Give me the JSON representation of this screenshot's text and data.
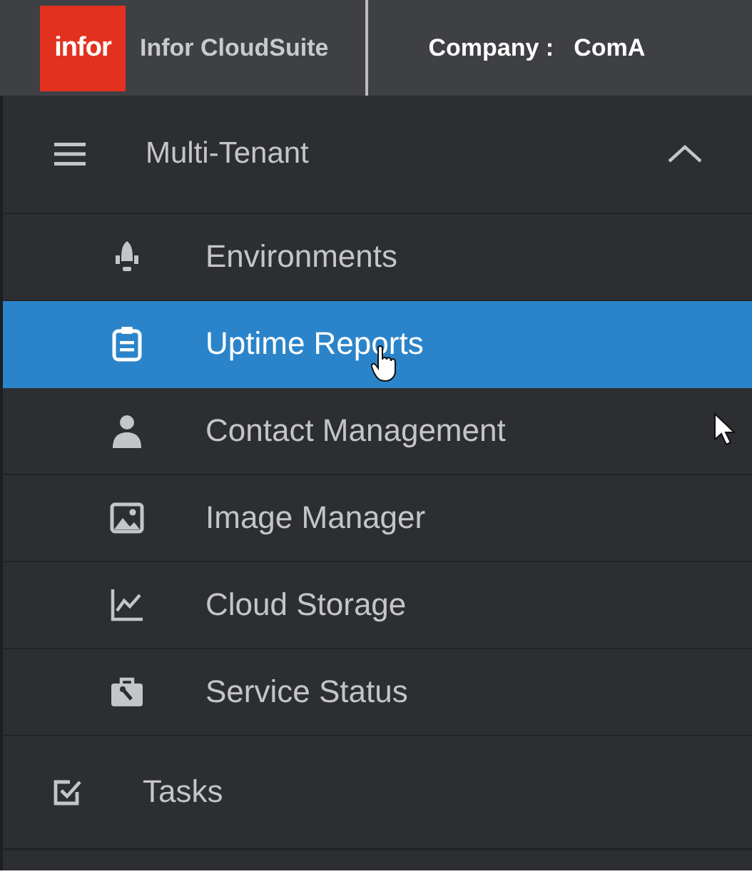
{
  "header": {
    "logo": "infor",
    "product": "Infor CloudSuite",
    "company_label": "Company :",
    "company_value": "ComA"
  },
  "menu": {
    "title": "Multi-Tenant",
    "expanded": true,
    "items": [
      {
        "label": "Environments",
        "selected": false
      },
      {
        "label": "Uptime Reports",
        "selected": true
      },
      {
        "label": "Contact Management",
        "selected": false
      },
      {
        "label": "Image Manager",
        "selected": false
      },
      {
        "label": "Cloud Storage",
        "selected": false
      },
      {
        "label": "Service Status",
        "selected": false
      }
    ]
  },
  "tasks": {
    "label": "Tasks"
  }
}
